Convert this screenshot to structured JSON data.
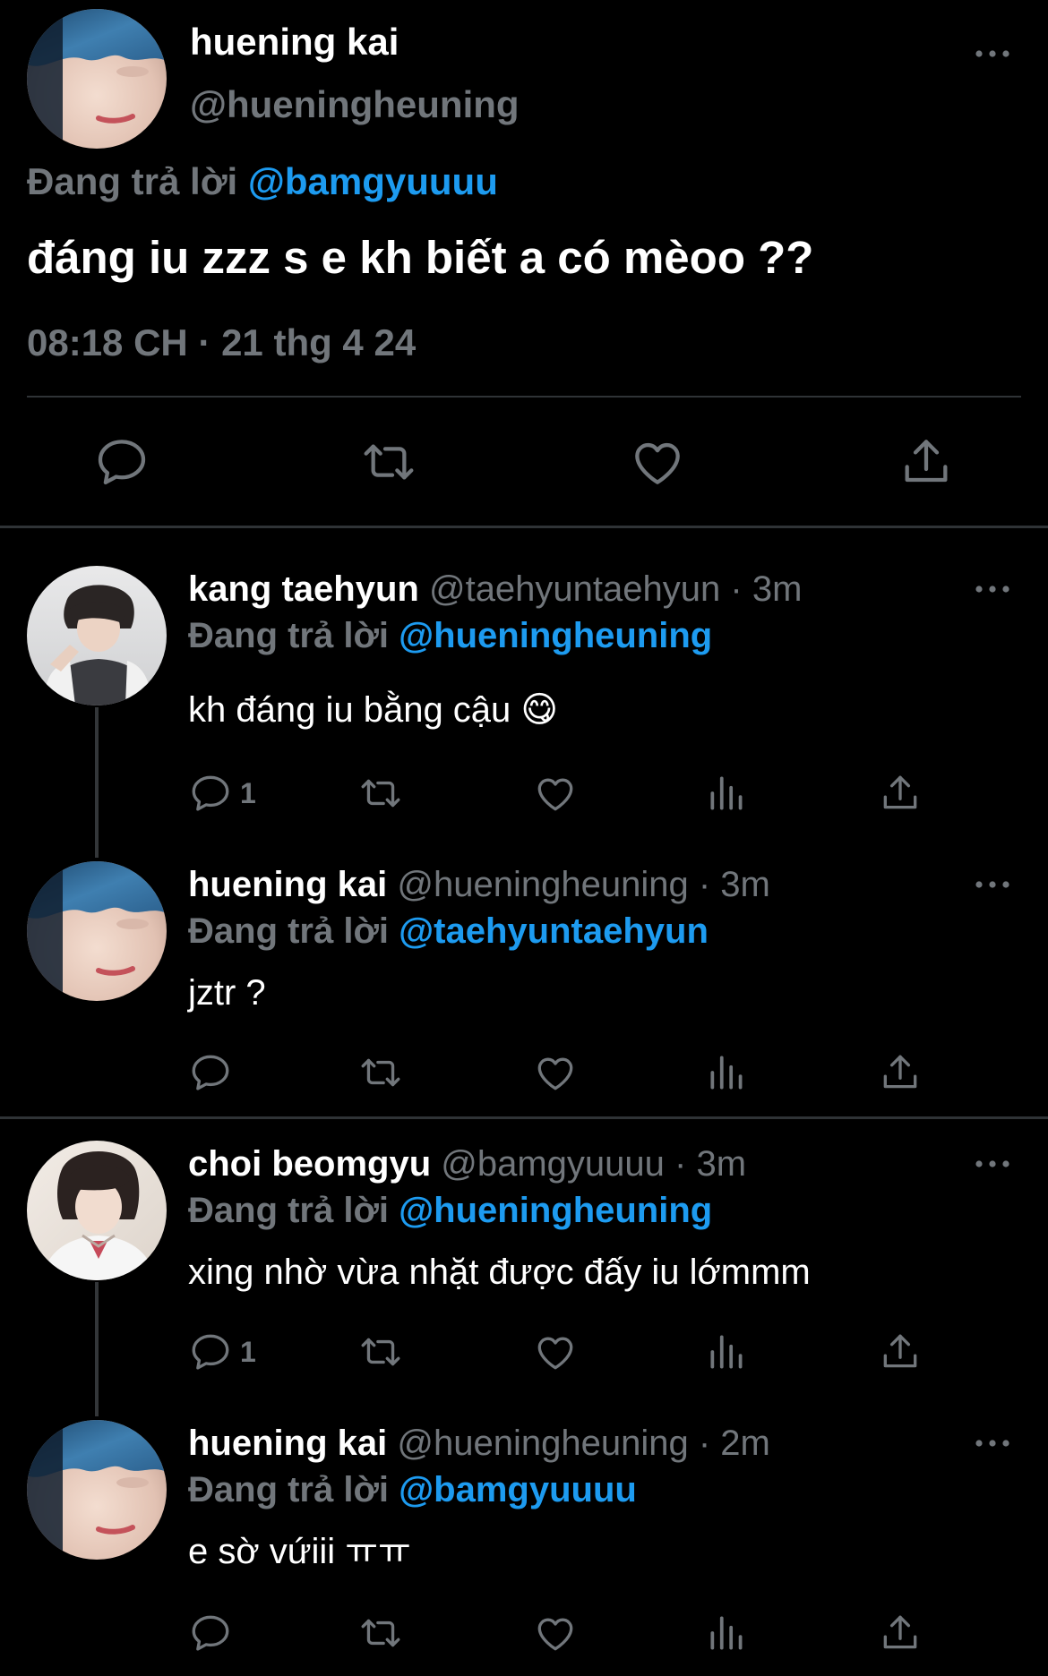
{
  "main_tweet": {
    "author_name": "huening kai",
    "author_handle": "@hueningheuning",
    "replying_prefix": "Đang trả lời",
    "replying_to": "@bamgyuuuu",
    "text": "đáng iu zzz s e kh biết a có mèoo ??",
    "timestamp": "08:18 CH · 21 thg 4 24"
  },
  "replies": [
    {
      "author_name": "kang taehyun",
      "author_handle": "@taehyuntaehyun",
      "time": "· 3m",
      "replying_prefix": "Đang trả lời",
      "replying_to": "@hueningheuning",
      "text": "kh đáng iu bằng cậu",
      "emoji": "😋",
      "reply_count": "1"
    },
    {
      "author_name": "huening kai",
      "author_handle": "@hueningheuning",
      "time": "· 3m",
      "replying_prefix": "Đang trả lời",
      "replying_to": "@taehyuntaehyun",
      "text": "jztr ?",
      "reply_count": ""
    },
    {
      "author_name": "choi beomgyu",
      "author_handle": "@bamgyuuuu",
      "time": "· 3m",
      "replying_prefix": "Đang trả lời",
      "replying_to": "@hueningheuning",
      "text": "xing nhờ vừa nhặt được đấy iu lớmmm",
      "reply_count": "1"
    },
    {
      "author_name": "huening kai",
      "author_handle": "@hueningheuning",
      "time": "· 2m",
      "replying_prefix": "Đang trả lời",
      "replying_to": "@bamgyuuuu",
      "text": "e sờ vứiii ㅠㅠ",
      "reply_count": ""
    }
  ],
  "colors": {
    "background": "#000000",
    "text": "#ffffff",
    "secondary": "#71767b",
    "accent": "#1d9bf0",
    "divider": "#2f3336"
  }
}
